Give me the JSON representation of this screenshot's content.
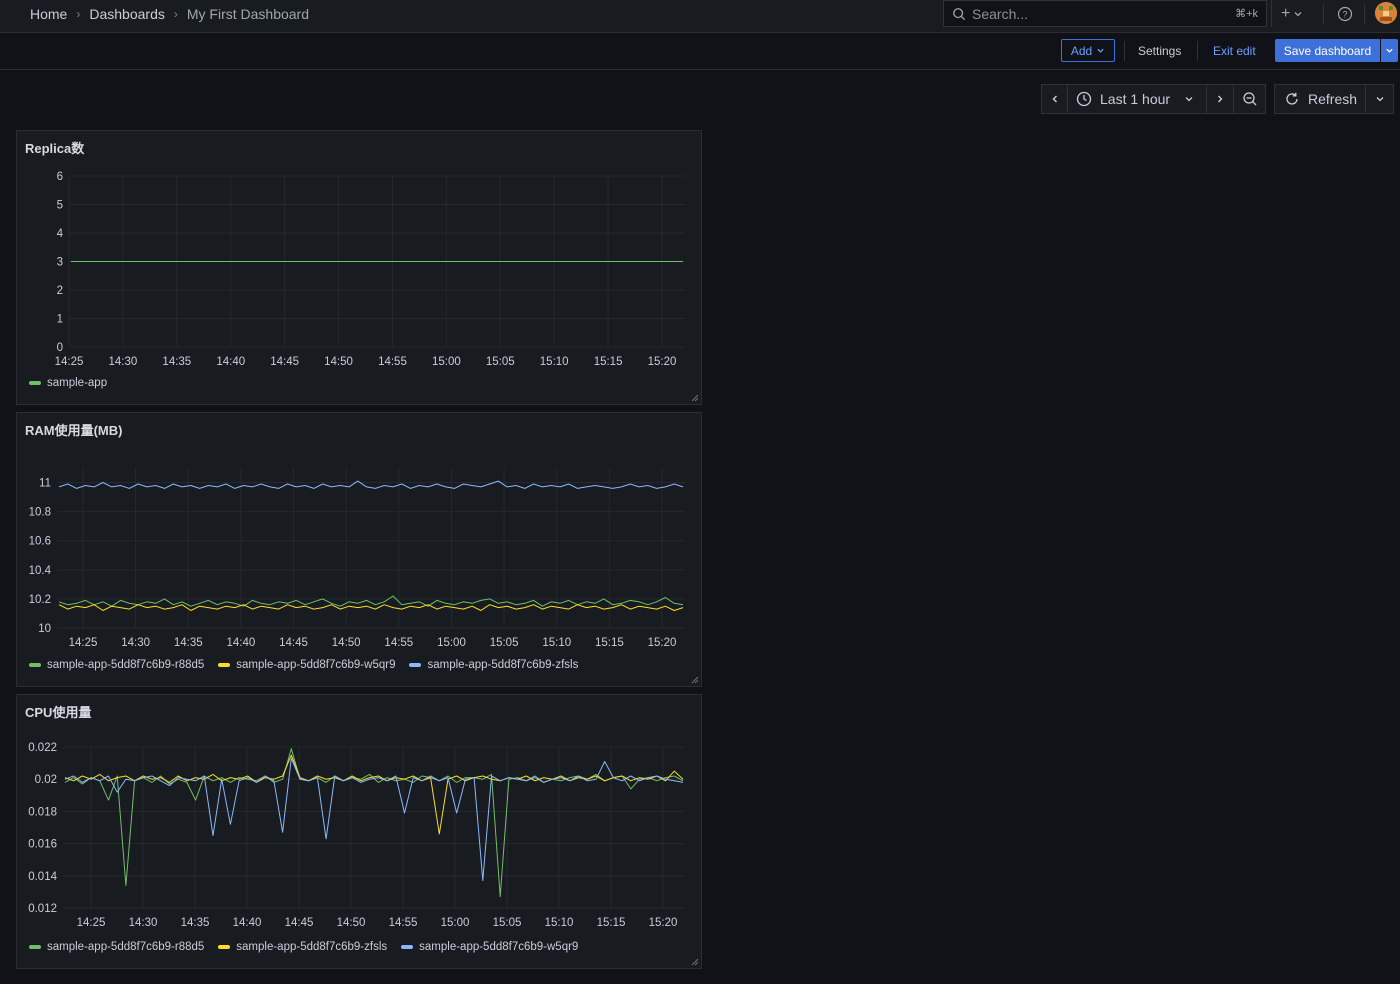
{
  "breadcrumb": {
    "home": "Home",
    "dashboards": "Dashboards",
    "current": "My First Dashboard"
  },
  "search": {
    "placeholder": "Search...",
    "shortcut": "⌘+k"
  },
  "toolbar": {
    "add": "Add",
    "settings": "Settings",
    "exit_edit": "Exit edit",
    "save": "Save dashboard"
  },
  "time_range": {
    "label": "Last 1 hour",
    "refresh": "Refresh"
  },
  "colors": {
    "green": "#73bf69",
    "yellow": "#fade2a",
    "blue": "#8ab8ff",
    "accent": "#3d71d9"
  },
  "panels": [
    {
      "title": "Replica数"
    },
    {
      "title": "RAM使用量(MB)"
    },
    {
      "title": "CPU使用量"
    }
  ],
  "chart_data": [
    {
      "type": "line",
      "title": "Replica数",
      "x": [
        "14:25",
        "14:30",
        "14:35",
        "14:40",
        "14:45",
        "14:50",
        "14:55",
        "15:00",
        "15:05",
        "15:10",
        "15:15",
        "15:20"
      ],
      "yticks": [
        "0",
        "1",
        "2",
        "3",
        "4",
        "5",
        "6"
      ],
      "ylim": [
        0,
        6
      ],
      "series": [
        {
          "name": "sample-app",
          "color": "green",
          "values": [
            3,
            3,
            3,
            3,
            3,
            3,
            3,
            3,
            3,
            3,
            3,
            3
          ]
        }
      ]
    },
    {
      "type": "line",
      "title": "RAM使用量(MB)",
      "x": [
        "14:25",
        "14:30",
        "14:35",
        "14:40",
        "14:45",
        "14:50",
        "14:55",
        "15:00",
        "15:05",
        "15:10",
        "15:15",
        "15:20"
      ],
      "yticks": [
        "10",
        "10.2",
        "10.4",
        "10.6",
        "10.8",
        "11"
      ],
      "ylim": [
        10,
        11.1
      ],
      "series": [
        {
          "name": "sample-app-5dd8f7c6b9-r88d5",
          "color": "green",
          "values": [
            10.18,
            10.16,
            10.17,
            10.19,
            10.16,
            10.18,
            10.15,
            10.19,
            10.17,
            10.16,
            10.18,
            10.17,
            10.2,
            10.16,
            10.18,
            10.15,
            10.17,
            10.19,
            10.16,
            10.18,
            10.17,
            10.15,
            10.19,
            10.17,
            10.16,
            10.18,
            10.17,
            10.19,
            10.16,
            10.18,
            10.2,
            10.17,
            10.15,
            10.18,
            10.17,
            10.19,
            10.16,
            10.18,
            10.22,
            10.16,
            10.17,
            10.18,
            10.15,
            10.19,
            10.17,
            10.16,
            10.18,
            10.17,
            10.19,
            10.2,
            10.17,
            10.18,
            10.16,
            10.17,
            10.19,
            10.15,
            10.18,
            10.17,
            10.19,
            10.16,
            10.18,
            10.17,
            10.2,
            10.16,
            10.17,
            10.19,
            10.18,
            10.16,
            10.18,
            10.21,
            10.17,
            10.16
          ]
        },
        {
          "name": "sample-app-5dd8f7c6b9-w5qr9",
          "color": "yellow",
          "values": [
            10.16,
            10.13,
            10.15,
            10.14,
            10.16,
            10.12,
            10.15,
            10.14,
            10.13,
            10.16,
            10.14,
            10.15,
            10.13,
            10.14,
            10.16,
            10.12,
            10.15,
            10.14,
            10.13,
            10.15,
            10.14,
            10.16,
            10.13,
            10.15,
            10.14,
            10.13,
            10.16,
            10.14,
            10.15,
            10.13,
            10.14,
            10.16,
            10.13,
            10.15,
            10.14,
            10.15,
            10.13,
            10.16,
            10.14,
            10.13,
            10.15,
            10.14,
            10.16,
            10.13,
            10.15,
            10.14,
            10.13,
            10.15,
            10.12,
            10.16,
            10.14,
            10.15,
            10.13,
            10.14,
            10.16,
            10.13,
            10.15,
            10.14,
            10.13,
            10.16,
            10.14,
            10.15,
            10.13,
            10.14,
            10.16,
            10.13,
            10.15,
            10.14,
            10.13,
            10.15,
            10.12,
            10.14
          ]
        },
        {
          "name": "sample-app-5dd8f7c6b9-zfsls",
          "color": "blue",
          "values": [
            10.97,
            10.99,
            10.96,
            10.98,
            10.97,
            11.0,
            10.97,
            10.98,
            10.96,
            10.99,
            10.97,
            10.98,
            10.96,
            10.99,
            10.97,
            10.98,
            10.96,
            10.98,
            10.97,
            10.99,
            10.96,
            10.98,
            10.97,
            10.99,
            10.97,
            10.96,
            10.99,
            10.97,
            10.98,
            10.96,
            10.99,
            10.97,
            10.98,
            10.97,
            11.01,
            10.97,
            10.96,
            10.98,
            10.97,
            10.99,
            10.96,
            10.98,
            10.97,
            10.99,
            10.97,
            10.96,
            10.99,
            10.98,
            10.97,
            10.99,
            11.01,
            10.97,
            10.98,
            10.96,
            10.99,
            10.97,
            10.98,
            10.97,
            10.99,
            10.96,
            10.97,
            10.98,
            10.97,
            10.96,
            10.97,
            10.99,
            10.97,
            10.98,
            10.96,
            10.97,
            10.99,
            10.97
          ]
        }
      ]
    },
    {
      "type": "line",
      "title": "CPU使用量",
      "x": [
        "14:25",
        "14:30",
        "14:35",
        "14:40",
        "14:45",
        "14:50",
        "14:55",
        "15:00",
        "15:05",
        "15:10",
        "15:15",
        "15:20"
      ],
      "yticks": [
        "0.012",
        "0.014",
        "0.016",
        "0.018",
        "0.02",
        "0.022"
      ],
      "ylim": [
        0.012,
        0.022
      ],
      "series": [
        {
          "name": "sample-app-5dd8f7c6b9-r88d5",
          "color": "green",
          "values": [
            0.0198,
            0.0201,
            0.0197,
            0.0201,
            0.0199,
            0.0187,
            0.0202,
            0.0134,
            0.0199,
            0.0201,
            0.0198,
            0.0202,
            0.0197,
            0.02,
            0.0198,
            0.0187,
            0.0202,
            0.0199,
            0.0201,
            0.0198,
            0.0201,
            0.02,
            0.0199,
            0.0202,
            0.0198,
            0.02,
            0.0219,
            0.02,
            0.0199,
            0.0201,
            0.0198,
            0.0202,
            0.0199,
            0.0201,
            0.02,
            0.0203,
            0.0198,
            0.0201,
            0.0199,
            0.02,
            0.0198,
            0.0202,
            0.0201,
            0.0199,
            0.0202,
            0.0198,
            0.0201,
            0.0201,
            0.02,
            0.0203,
            0.0127,
            0.02,
            0.0201,
            0.0199,
            0.0201,
            0.0198,
            0.02,
            0.0199,
            0.0201,
            0.0202,
            0.02,
            0.0203,
            0.0199,
            0.0201,
            0.0202,
            0.0194,
            0.02,
            0.0201,
            0.0199,
            0.0201,
            0.0202,
            0.0199
          ]
        },
        {
          "name": "sample-app-5dd8f7c6b9-zfsls",
          "color": "yellow",
          "values": [
            0.0201,
            0.0199,
            0.0202,
            0.02,
            0.0203,
            0.0199,
            0.0201,
            0.0202,
            0.0199,
            0.0202,
            0.02,
            0.0201,
            0.0198,
            0.0202,
            0.0199,
            0.0201,
            0.02,
            0.0203,
            0.0199,
            0.0201,
            0.02,
            0.0202,
            0.0198,
            0.0201,
            0.02,
            0.0202,
            0.0215,
            0.0201,
            0.0199,
            0.0202,
            0.02,
            0.0201,
            0.0199,
            0.0202,
            0.0199,
            0.0201,
            0.0202,
            0.0199,
            0.0201,
            0.02,
            0.0202,
            0.0199,
            0.0201,
            0.0166,
            0.02,
            0.0202,
            0.0199,
            0.0201,
            0.0202,
            0.02,
            0.0199,
            0.0201,
            0.02,
            0.0202,
            0.0199,
            0.0201,
            0.02,
            0.0202,
            0.0199,
            0.0201,
            0.02,
            0.0202,
            0.0199,
            0.0201,
            0.0202,
            0.0199,
            0.0201,
            0.02,
            0.0202,
            0.0199,
            0.0205,
            0.02
          ]
        },
        {
          "name": "sample-app-5dd8f7c6b9-w5qr9",
          "color": "blue",
          "values": [
            0.02,
            0.0202,
            0.0198,
            0.0201,
            0.0199,
            0.0202,
            0.0192,
            0.02,
            0.0199,
            0.0201,
            0.0202,
            0.0199,
            0.0196,
            0.0201,
            0.02,
            0.0199,
            0.0202,
            0.0165,
            0.02,
            0.0172,
            0.0199,
            0.0201,
            0.0198,
            0.0202,
            0.0199,
            0.0167,
            0.0213,
            0.02,
            0.0199,
            0.0201,
            0.0163,
            0.0202,
            0.0199,
            0.0201,
            0.0198,
            0.02,
            0.0201,
            0.0199,
            0.0202,
            0.0179,
            0.0201,
            0.0199,
            0.0202,
            0.0199,
            0.0201,
            0.0179,
            0.02,
            0.0201,
            0.0137,
            0.0202,
            0.0199,
            0.0201,
            0.02,
            0.0199,
            0.0202,
            0.0198,
            0.02,
            0.0201,
            0.0199,
            0.0202,
            0.0199,
            0.02,
            0.0211,
            0.0201,
            0.0199,
            0.0202,
            0.0199,
            0.0201,
            0.0202,
            0.02,
            0.0199,
            0.0198
          ]
        }
      ]
    }
  ]
}
